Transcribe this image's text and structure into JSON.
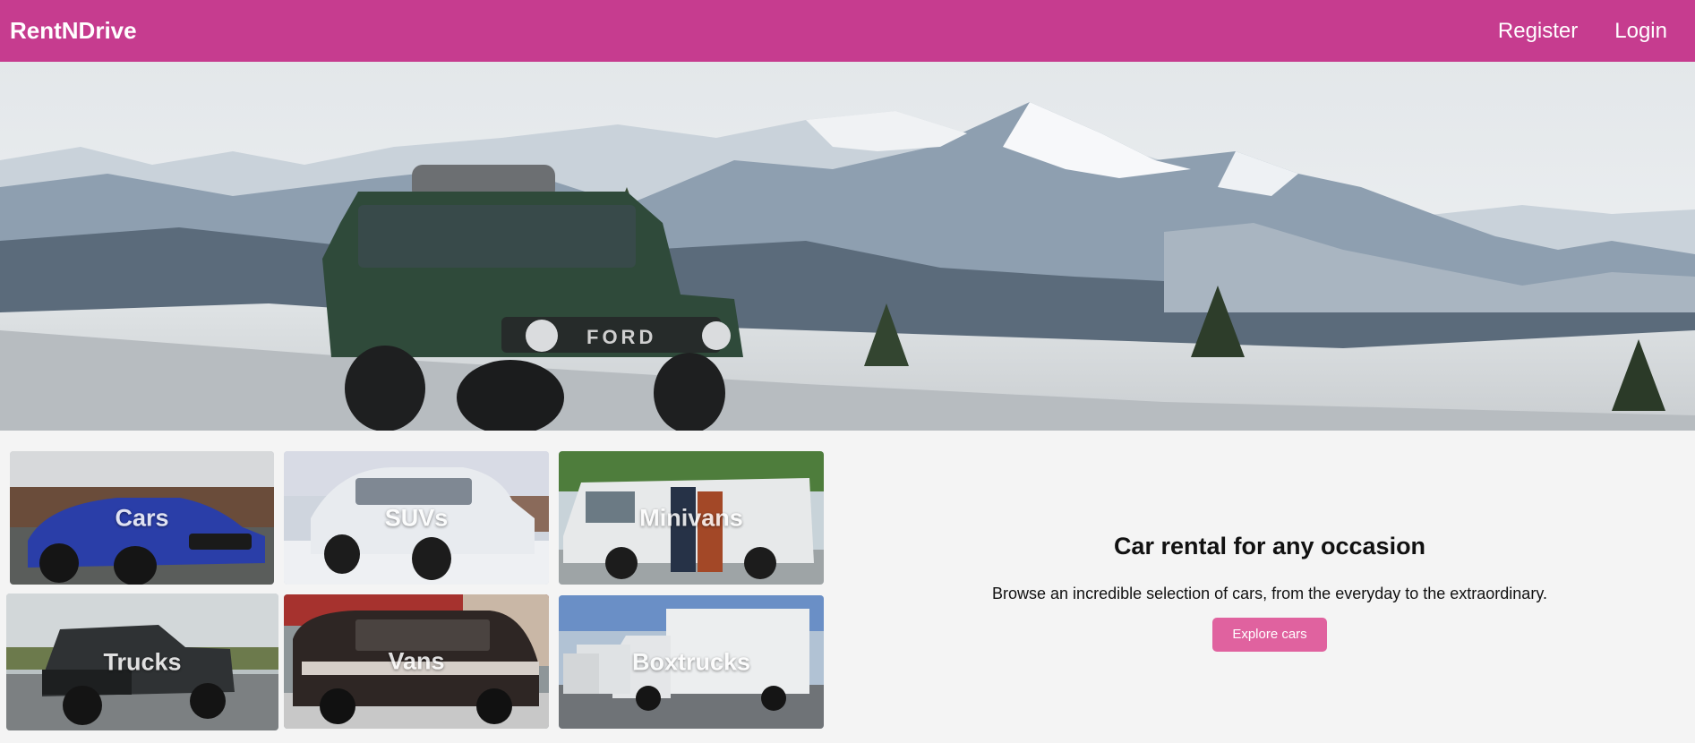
{
  "navbar": {
    "brand": "RentNDrive",
    "links": {
      "register": "Register",
      "login": "Login"
    }
  },
  "hero": {
    "image": "green SUV on snowy mountain road"
  },
  "categories": [
    {
      "label": "Cars"
    },
    {
      "label": "SUVs"
    },
    {
      "label": "Minivans"
    },
    {
      "label": "Trucks"
    },
    {
      "label": "Vans"
    },
    {
      "label": "Boxtrucks"
    }
  ],
  "promo": {
    "title": "Car rental for any occasion",
    "description": "Browse an incredible selection of cars, from the everyday to the extraordinary.",
    "button": "Explore cars"
  },
  "colors": {
    "brand": "#c63c8f",
    "button": "#e0629f",
    "background": "#f4f4f4"
  }
}
